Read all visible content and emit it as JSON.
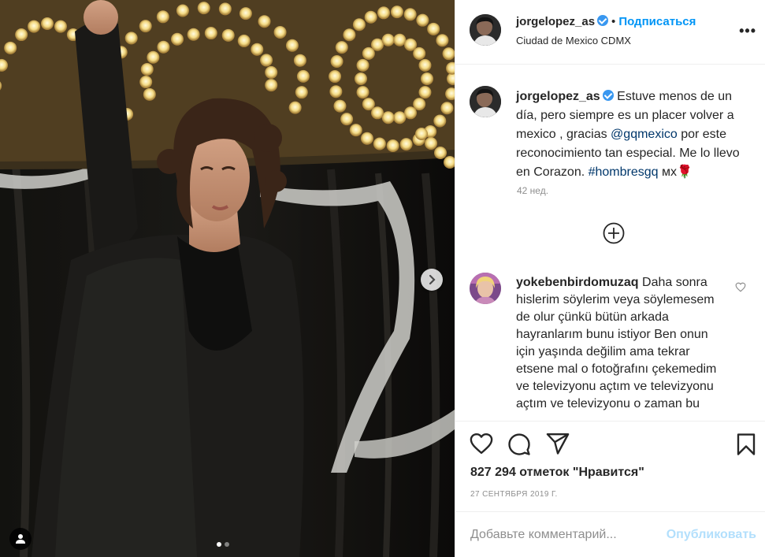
{
  "post": {
    "username": "jorgelopez_as",
    "follow_label": "Подписаться",
    "separator": "•",
    "location": "Ciudad de Mexico CDMX",
    "more_label": "•••",
    "caption": {
      "username": "jorgelopez_as",
      "text_1": " Estuve menos de un día, pero siempre es un placer volver a mexico , gracias ",
      "mention": "@gqmexico",
      "text_2": " por este reconocimiento tan especial. Me lo llevo en Corazon. ",
      "hashtag": "#hombresgq",
      "text_3": " мх🌹",
      "ago": "42 нед."
    },
    "comments": [
      {
        "username": "yokebenbirdomuzaq",
        "text": " Daha sonra hislerim söylerim veya söylemesem de olur çünkü bütün arkada hayranlarım bunu istiyor Ben onun için yaşında değilim ama tekrar etsene mal o fotoğrafını çekemedim ve televizyonu açtım ve televizyonu açtım ve televizyonu o zaman bu"
      }
    ],
    "likes": "827 294 отметок \"Нравится\"",
    "date": "27 сентября 2019 г.",
    "comment_placeholder": "Добавьте комментарий...",
    "publish_label": "Опубликовать",
    "carousel": {
      "count": 2,
      "active": 0
    }
  },
  "icons": {
    "verified": "verified-badge-icon",
    "load_more": "plus-circle-icon",
    "comment_like": "heart-outline-icon",
    "like": "heart-icon",
    "comment": "comment-bubble-icon",
    "share": "paper-plane-icon",
    "save": "bookmark-icon",
    "next": "chevron-right-icon",
    "user_tags": "user-icon"
  },
  "colors": {
    "accent": "#0095f6",
    "mention": "#00376b",
    "muted": "#8e8e8e",
    "verified": "#3897f0",
    "publish_disabled": "#b2dffc"
  }
}
